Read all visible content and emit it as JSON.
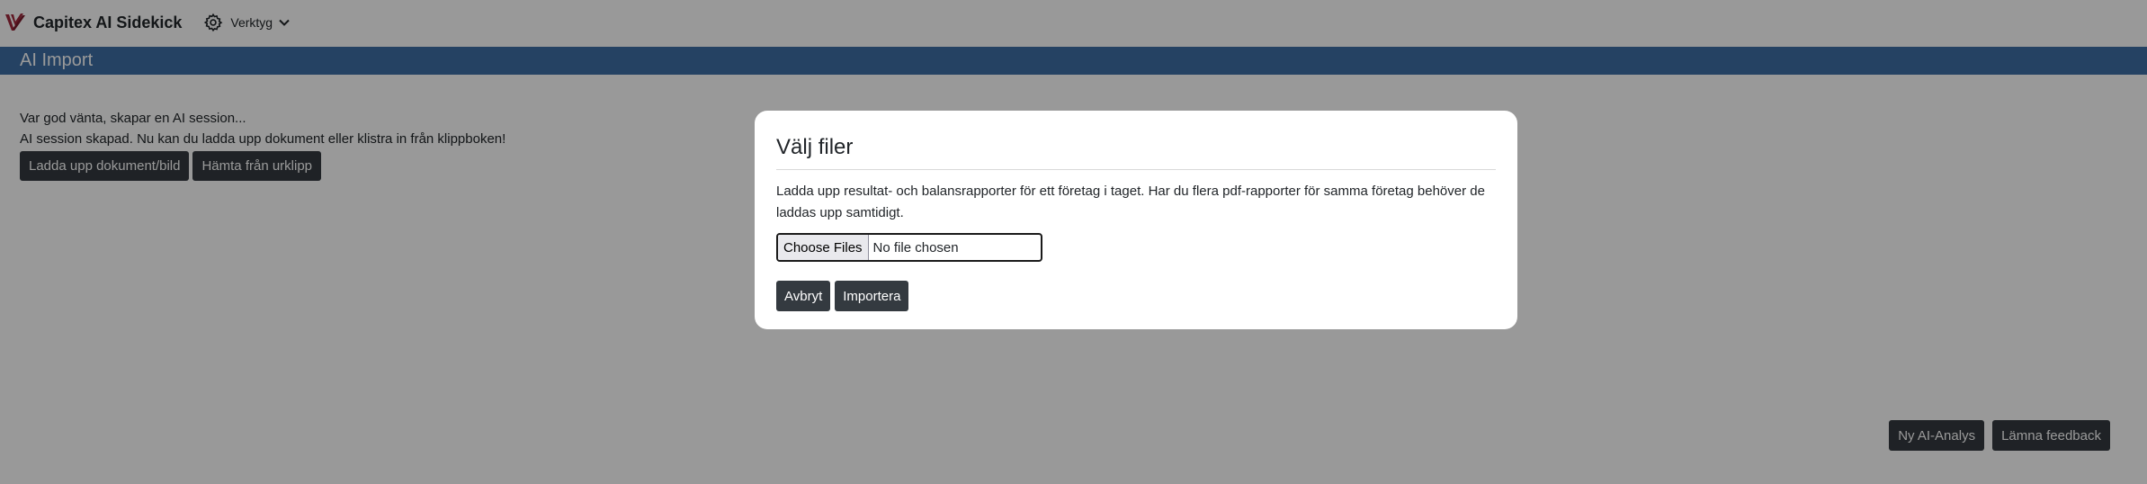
{
  "navbar": {
    "brand": "Capitex AI Sidekick",
    "tools_label": "Verktyg"
  },
  "header": {
    "title": "AI Import"
  },
  "content": {
    "status_waiting": "Var god vänta, skapar en AI session...",
    "status_created": "AI session skapad. Nu kan du ladda upp dokument eller klistra in från klippboken!",
    "upload_button": "Ladda upp dokument/bild",
    "clipboard_button": "Hämta från urklipp"
  },
  "footer": {
    "new_analysis_button": "Ny AI-Analys",
    "feedback_button": "Lämna feedback"
  },
  "modal": {
    "title": "Välj filer",
    "description": "Ladda upp resultat- och balansrapporter för ett företag i taget. Har du flera pdf-rapporter för samma företag behöver de laddas upp samtidigt.",
    "choose_files_label": "Choose Files",
    "file_status": "No file chosen",
    "cancel_button": "Avbryt",
    "import_button": "Importera"
  },
  "colors": {
    "header_bar": "#3f6fa5",
    "button_dark": "#343a40",
    "brand_logo": "#a0283c",
    "overlay": "rgba(0,0,0,0.4)"
  },
  "icons": {
    "brand": "capitex-logo-icon",
    "tools": "gear-icon",
    "dropdown": "chevron-down-icon"
  }
}
